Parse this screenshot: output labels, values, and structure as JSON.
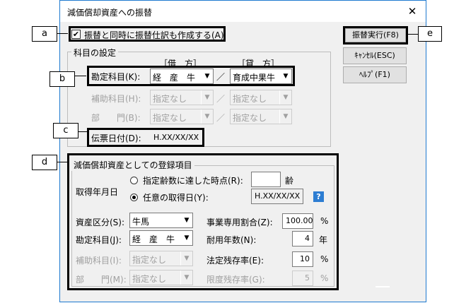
{
  "window": {
    "title": "減価償却資産への振替",
    "close_glyph": "✕"
  },
  "callouts": {
    "a": "a",
    "b": "b",
    "c": "c",
    "d": "d",
    "e": "e"
  },
  "checkbox": {
    "label": "振替と同時に振替仕訳も作成する(A)",
    "checked": true
  },
  "buttons": {
    "execute": "振替実行(F8)",
    "cancel": "ｷｬﾝｾﾙ(ESC)",
    "help": "ﾍﾙﾌﾟ(F1)"
  },
  "account_settings": {
    "group_title": "科目の設定",
    "debit_header": "［借　方］",
    "credit_header": "［貸　方］",
    "separator": "／",
    "rows": [
      {
        "label": "勘定科目(K):",
        "debit": "経　産　牛",
        "credit": "育成中果牛"
      },
      {
        "label": "補助科目(H):",
        "debit": "指定なし",
        "credit": "指定なし"
      },
      {
        "label": "部　　門(B):",
        "debit": "指定なし",
        "credit": "指定なし"
      }
    ],
    "voucher_date_label": "伝票日付(D):",
    "voucher_date_value": "H.XX/XX/XX"
  },
  "registration": {
    "group_title": "減価償却資産としての登録項目",
    "acquisition_label": "取得年月日",
    "radio_age_label": "指定齢数に達した時点(R):",
    "radio_age_unit": "齢",
    "radio_age_value": "",
    "radio_date_label": "任意の取得日(Y):",
    "radio_date_value": "H.XX/XX/XX",
    "help_icon_glyph": "?",
    "asset_class_label": "資産区分(S):",
    "asset_class_value": "牛馬",
    "account_label": "勘定科目(J):",
    "account_value": "経　産　牛",
    "sub_account_label": "補助科目(I):",
    "sub_account_value": "指定なし",
    "department_label": "部　　門(M):",
    "department_value": "指定なし",
    "business_ratio_label": "事業専用割合(Z):",
    "business_ratio_value": "100.00",
    "business_ratio_unit": "%",
    "useful_life_label": "耐用年数(N):",
    "useful_life_value": "4",
    "useful_life_unit": "年",
    "residual_rate_label": "法定残存率(E):",
    "residual_rate_value": "10",
    "residual_rate_unit": "%",
    "limit_rate_label": "限度残存率(G):",
    "limit_rate_value": "5",
    "limit_rate_unit": "%"
  }
}
